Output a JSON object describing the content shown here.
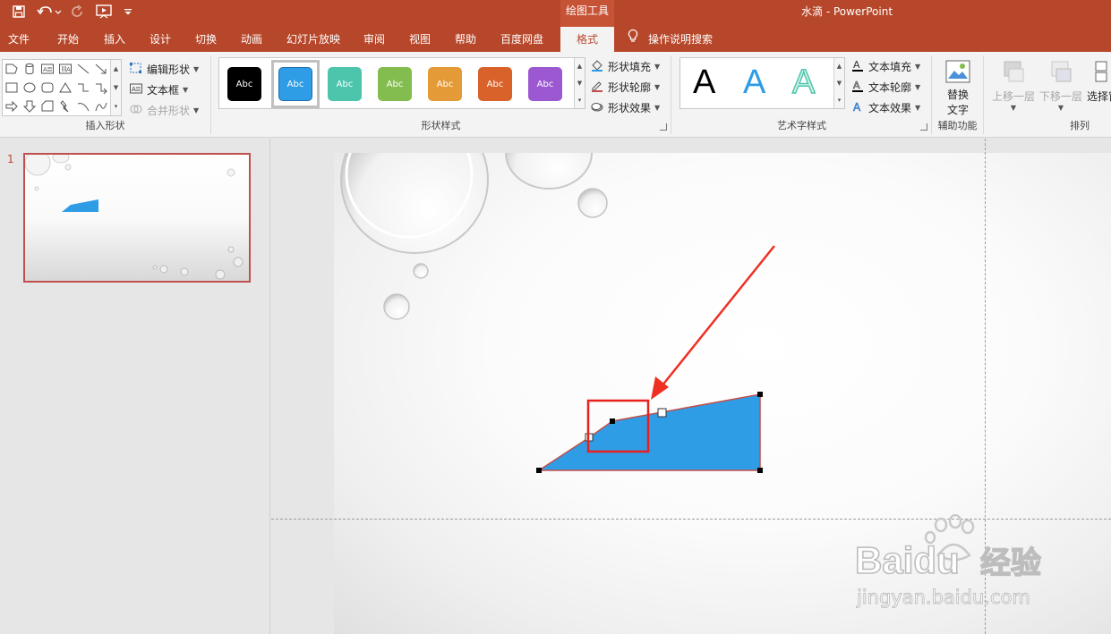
{
  "title_bar": {
    "context_label": "绘图工具",
    "document_title": "水滴  -  PowerPoint"
  },
  "tabs": [
    {
      "label": "文件"
    },
    {
      "label": "开始"
    },
    {
      "label": "插入"
    },
    {
      "label": "设计"
    },
    {
      "label": "切换"
    },
    {
      "label": "动画"
    },
    {
      "label": "幻灯片放映"
    },
    {
      "label": "审阅"
    },
    {
      "label": "视图"
    },
    {
      "label": "帮助"
    },
    {
      "label": "百度网盘"
    },
    {
      "label": "格式",
      "active": true
    }
  ],
  "tell_me": "操作说明搜索",
  "ribbon": {
    "insert_shapes": {
      "label": "插入形状",
      "edit_shape": "编辑形状",
      "text_box": "文本框",
      "merge_shapes": "合并形状"
    },
    "shape_styles": {
      "label": "形状样式",
      "swatch_text": "Abc",
      "swatches": [
        "#000000",
        "#2e9de6",
        "#4cc5ac",
        "#84bd4f",
        "#e39a37",
        "#d9612a",
        "#9b58d1"
      ],
      "selected_index": 1,
      "fill": "形状填充",
      "outline": "形状轮廓",
      "effects": "形状效果"
    },
    "wordart_styles": {
      "label": "艺术字样式",
      "letter": "A",
      "text_fill": "文本填充",
      "text_outline": "文本轮廓",
      "text_effects": "文本效果"
    },
    "accessibility": {
      "label": "辅助功能",
      "alt_text_line1": "替换",
      "alt_text_line2": "文字"
    },
    "arrange": {
      "label": "排列",
      "bring_forward": "上移一层",
      "send_backward": "下移一层",
      "selection_pane": "选择窗"
    }
  },
  "slides_pane": {
    "slide_number": "1"
  },
  "colors": {
    "accent": "#b7472a",
    "shape_fill": "#2e9de6",
    "shape_outline": "#c0504d",
    "highlight_box": "#e8211f",
    "arrow": "#ef2f24"
  },
  "watermark": {
    "brand": "Baidu",
    "suffix": "经验",
    "url": "jingyan.baidu.com"
  }
}
